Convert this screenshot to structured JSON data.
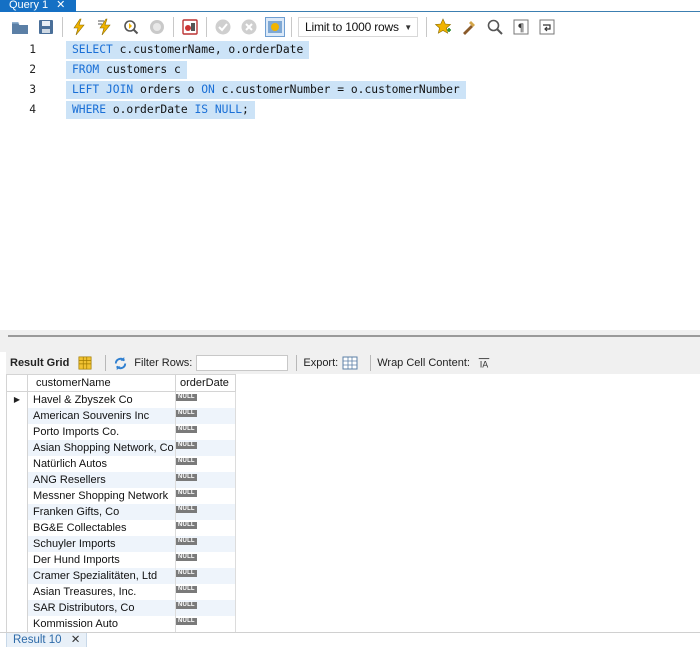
{
  "tab": {
    "label": "Query 1",
    "close": "✕"
  },
  "toolbar": {
    "limit_label": "Limit to 1000 rows",
    "icons": [
      "open-folder-icon",
      "save-icon",
      "execute-icon",
      "execute-current-icon",
      "explain-icon",
      "stop-icon",
      "toggle-output-icon",
      "commit-icon",
      "rollback-icon",
      "autocommit-icon",
      "bookmark-icon",
      "beautify-icon",
      "find-icon",
      "invisible-chars-icon",
      "wrap-icon"
    ]
  },
  "editor": {
    "lines": [
      {
        "num": "1",
        "kw1": "SELECT",
        "rest1": " c.customerName, o.orderDate",
        "kw2": "",
        "rest2": "",
        "kw3": "",
        "rest3": ""
      },
      {
        "num": "2",
        "kw1": "FROM",
        "rest1": " customers c",
        "kw2": "",
        "rest2": "",
        "kw3": "",
        "rest3": ""
      },
      {
        "num": "3",
        "kw1": "LEFT JOIN",
        "rest1": " orders o ",
        "kw2": "ON",
        "rest2": " c.customerNumber = o.customerNumber",
        "kw3": "",
        "rest3": ""
      },
      {
        "num": "4",
        "kw1": "WHERE",
        "rest1": " o.orderDate ",
        "kw2": "IS NULL",
        "rest2": ";",
        "kw3": "",
        "rest3": ""
      }
    ]
  },
  "results_toolbar": {
    "result_grid": "Result Grid",
    "filter_rows": "Filter Rows:",
    "filter_value": "",
    "export": "Export:",
    "wrap": "Wrap Cell Content:"
  },
  "grid": {
    "columns": [
      "customerName",
      "orderDate"
    ],
    "null_label": "NULL",
    "rows": [
      "Havel & Zbyszek Co",
      "American Souvenirs Inc",
      "Porto Imports Co.",
      "Asian Shopping Network, Co",
      "Natürlich Autos",
      "ANG Resellers",
      "Messner Shopping Network",
      "Franken Gifts, Co",
      "BG&E Collectables",
      "Schuyler Imports",
      "Der Hund Imports",
      "Cramer Spezialitäten, Ltd",
      "Asian Treasures, Inc.",
      "SAR Distributors, Co",
      "Kommission Auto",
      ""
    ]
  },
  "bottom_tab": {
    "label": "Result 10",
    "close": "✕"
  }
}
